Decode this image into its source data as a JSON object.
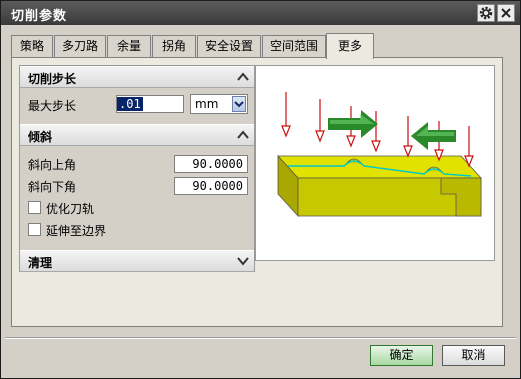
{
  "window": {
    "title": "切削参数"
  },
  "tabs": [
    {
      "label": "策略"
    },
    {
      "label": "多刀路"
    },
    {
      "label": "余量"
    },
    {
      "label": "拐角"
    },
    {
      "label": "安全设置"
    },
    {
      "label": "空间范围"
    },
    {
      "label": "更多",
      "active": true
    }
  ],
  "sections": {
    "step": {
      "title": "切削步长",
      "max_step_label": "最大步长",
      "max_step_value": ".01",
      "unit": "mm"
    },
    "tilt": {
      "title": "倾斜",
      "up_label": "斜向上角",
      "up_value": "90.0000",
      "down_label": "斜向下角",
      "down_value": "90.0000",
      "opt_toolpath_label": "优化刀轨",
      "extend_label": "延伸至边界"
    },
    "cleanup": {
      "title": "清理"
    }
  },
  "buttons": {
    "ok": "确定",
    "cancel": "取消"
  },
  "icons": {
    "settings": "gear-icon",
    "close": "close-icon",
    "collapse": "chevron-up-icon",
    "expand": "chevron-down-icon",
    "dropdown": "chevron-down-icon"
  },
  "colors": {
    "part": "#c8c800",
    "arrow_red": "#cc1111",
    "arrow_green": "#2a8a2a",
    "toolpath": "#00c8c8"
  }
}
